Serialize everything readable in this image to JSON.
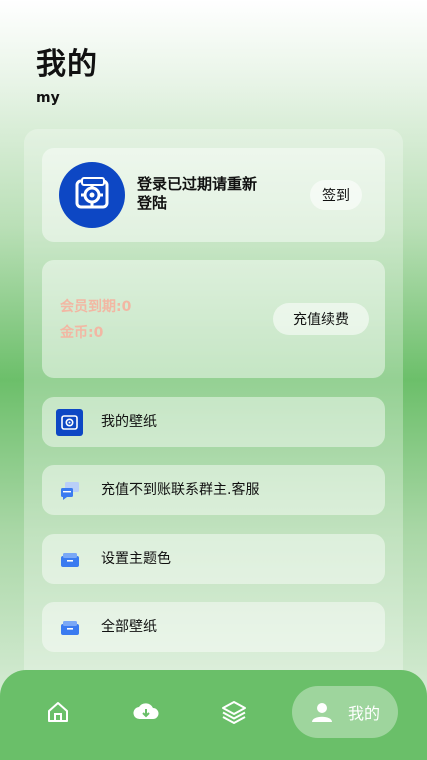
{
  "header": {
    "title": "我的",
    "subtitle": "my"
  },
  "profile": {
    "login_prompt": "登录已过期请重新登陆",
    "signin_label": "签到"
  },
  "vip": {
    "expiry_text": "会员到期:0",
    "coins_text": "金币:0",
    "recharge_label": "充值续费"
  },
  "menu": {
    "items": [
      {
        "label": "我的壁纸",
        "icon": "wallpaper-app-icon"
      },
      {
        "label": "充值不到账联系群主.客服",
        "icon": "chat-icon"
      },
      {
        "label": "设置主题色",
        "icon": "theme-box-icon"
      },
      {
        "label": "全部壁纸",
        "icon": "all-wallpaper-box-icon"
      }
    ]
  },
  "nav": {
    "items": [
      {
        "icon": "home-icon"
      },
      {
        "icon": "cloud-download-icon"
      },
      {
        "icon": "layers-icon"
      },
      {
        "icon": "user-icon",
        "label": "我的"
      }
    ]
  },
  "colors": {
    "accent_green": "#6abf69",
    "avatar_blue": "#0d47c4",
    "vip_text": "#f2b7a3",
    "icon_blue": "#3a7bf0"
  }
}
